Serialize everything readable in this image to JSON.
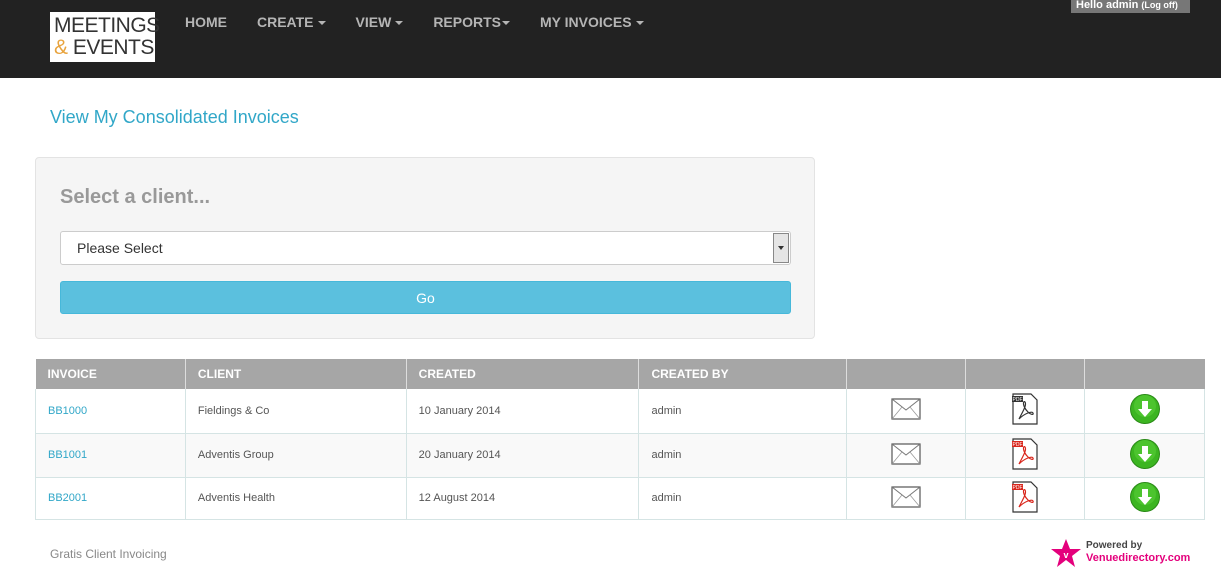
{
  "brand": {
    "line1": "MEETINGS",
    "amp": "&",
    "line2": " EVENTS"
  },
  "nav": {
    "home": "HOME",
    "create": "CREATE",
    "view": "VIEW",
    "reports": "REPORTS",
    "my_invoices": "MY INVOICES"
  },
  "user": {
    "greeting": "Hello admin",
    "logoff": "(Log off)"
  },
  "page": {
    "link": "View My Consolidated Invoices"
  },
  "client_form": {
    "title": "Select a client...",
    "select_value": "Please Select",
    "go_label": "Go"
  },
  "table": {
    "headers": [
      "INVOICE",
      "CLIENT",
      "CREATED",
      "CREATED BY",
      "",
      "",
      ""
    ],
    "rows": [
      {
        "invoice": "BB1000",
        "client": "Fieldings & Co",
        "created": "10 January 2014",
        "created_by": "admin"
      },
      {
        "invoice": "BB1001",
        "client": "Adventis Group",
        "created": "20 January 2014",
        "created_by": "admin"
      },
      {
        "invoice": "BB2001",
        "client": "Adventis Health",
        "created": "12 August 2014",
        "created_by": "admin"
      }
    ]
  },
  "footer": {
    "text": "Gratis Client Invoicing",
    "powered_by": "Powered by",
    "venue": "Venuedirectory.com"
  },
  "colors": {
    "navbar": "#222222",
    "accent": "#31a7c8",
    "go_button": "#5bc0de",
    "table_header": "#a6a6a6",
    "pdf_red": "#d9261c",
    "download_green": "#3cb521",
    "venue_pink": "#e4007c"
  },
  "icons": [
    "envelope-icon",
    "pdf-icon",
    "download-icon",
    "star-icon"
  ]
}
